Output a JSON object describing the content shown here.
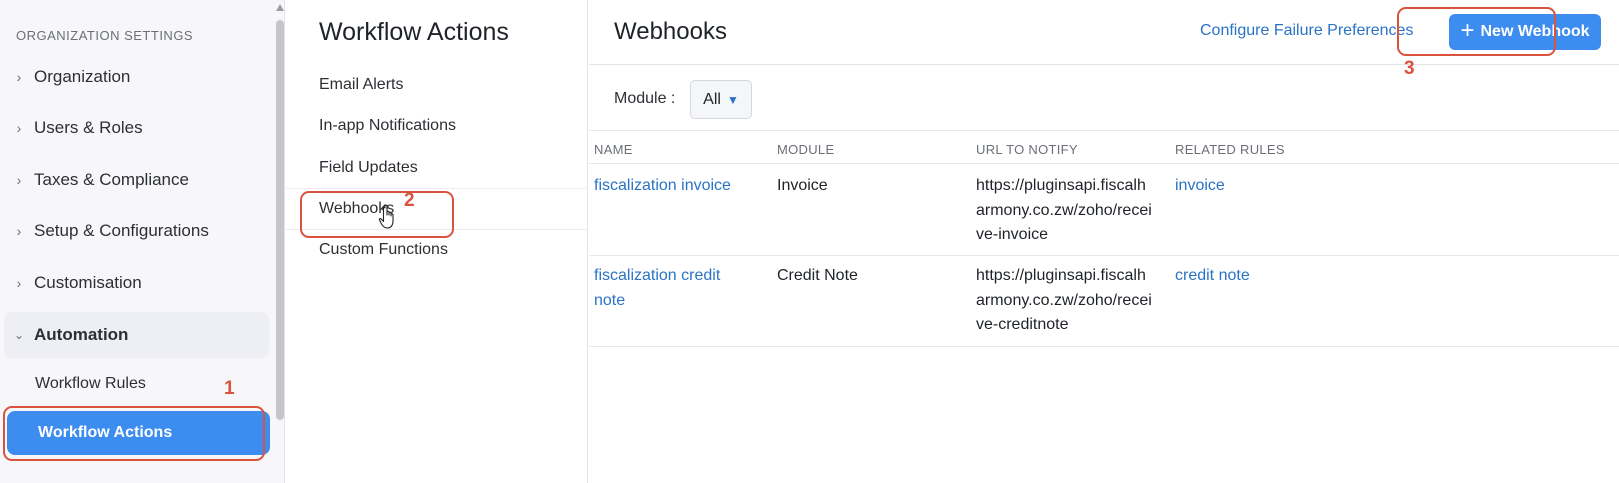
{
  "sidebar": {
    "header": "ORGANIZATION SETTINGS",
    "items": [
      {
        "label": "Organization"
      },
      {
        "label": "Users & Roles"
      },
      {
        "label": "Taxes & Compliance"
      },
      {
        "label": "Setup & Configurations"
      },
      {
        "label": "Customisation"
      },
      {
        "label": "Automation"
      }
    ],
    "subitems": [
      {
        "label": "Workflow Rules"
      },
      {
        "label": "Workflow Actions"
      }
    ]
  },
  "middle": {
    "title": "Workflow Actions",
    "items": [
      {
        "label": "Email Alerts"
      },
      {
        "label": "In-app Notifications"
      },
      {
        "label": "Field Updates"
      },
      {
        "label": "Webhooks"
      },
      {
        "label": "Custom Functions"
      }
    ]
  },
  "main": {
    "title": "Webhooks",
    "configure_link": "Configure Failure Preferences",
    "new_button": "New Webhook",
    "module_label": "Module :",
    "module_value": "All",
    "columns": [
      "NAME",
      "MODULE",
      "URL TO NOTIFY",
      "RELATED RULES"
    ],
    "rows": [
      {
        "name": [
          "fiscalization invoice"
        ],
        "module": "Invoice",
        "url": [
          "https://pluginsapi.fiscalh",
          "armony.co.zw/zoho/recei",
          "ve-invoice"
        ],
        "rule": "invoice"
      },
      {
        "name": [
          "fiscalization credit",
          "note"
        ],
        "module": "Credit Note",
        "url": [
          "https://pluginsapi.fiscalh",
          "armony.co.zw/zoho/recei",
          "ve-creditnote"
        ],
        "rule": "credit note"
      }
    ]
  },
  "annotations": [
    "1",
    "2",
    "3"
  ],
  "colors": {
    "accent": "#3d8cf0",
    "link": "#2a73c5",
    "annotation": "#d9533f"
  }
}
